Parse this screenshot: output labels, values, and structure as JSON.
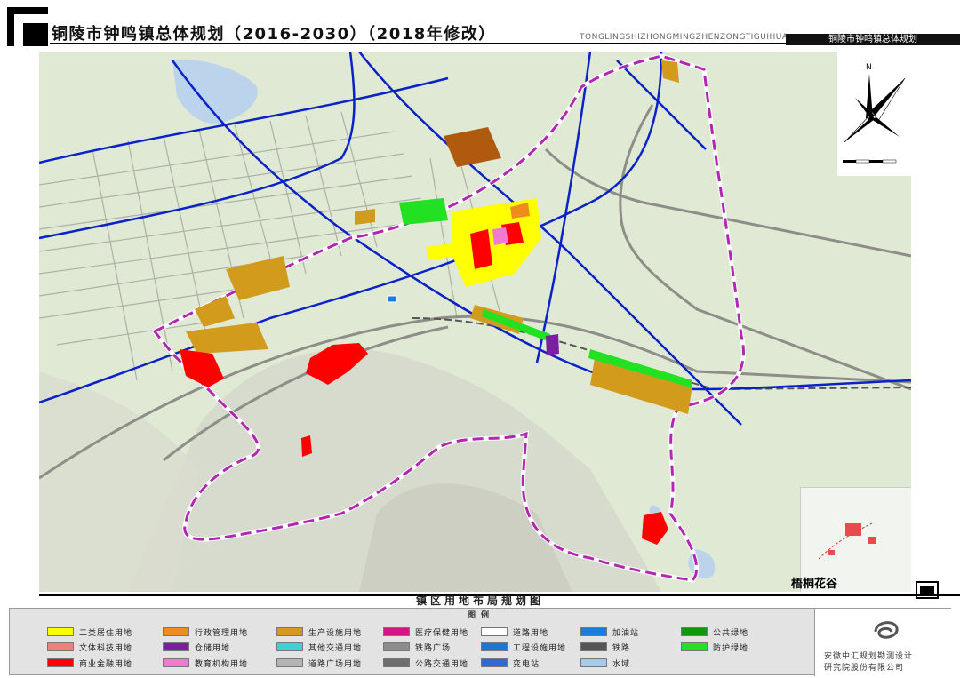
{
  "header": {
    "title": "铜陵市钟鸣镇总体规划（2016-2030）（2018年修改）",
    "pinyin": "TONGLINGSHIZHONGMINGZHENZONGTIGUIHUA",
    "right_label": "铜陵市钟鸣镇总体规划"
  },
  "map": {
    "title": "镇区用地布局规划图",
    "inset_label": "梧桐花谷",
    "compass_north": "N",
    "colors": {
      "background": "#dfe9d3",
      "terrain": "#d3d3c8",
      "water": "#bcd3ec",
      "road_major": "#0a22c8",
      "boundary": "#b226b2"
    }
  },
  "legend": {
    "title": "图例",
    "items": [
      {
        "label": "二类居住用地",
        "color": "#ffff00"
      },
      {
        "label": "文体科技用地",
        "color": "#f08080"
      },
      {
        "label": "商业金融用地",
        "color": "#ff0000"
      },
      {
        "label": "行政管理用地",
        "color": "#f08c1e"
      },
      {
        "label": "仓储用地",
        "color": "#7a1fa0"
      },
      {
        "label": "教育机构用地",
        "color": "#f07ad2"
      },
      {
        "label": "生产设施用地",
        "color": "#d39b1c"
      },
      {
        "label": "其他交通用地",
        "color": "#3fd0d0"
      },
      {
        "label": "道路广场用地",
        "color": "#b4b4b4"
      },
      {
        "label": "医疗保健用地",
        "color": "#d3158a"
      },
      {
        "label": "铁路广场",
        "color": "#8c8c8c"
      },
      {
        "label": "公路交通用地",
        "color": "#6e6e6e"
      },
      {
        "label": "道路用地",
        "color": "#ffffff"
      },
      {
        "label": "工程设施用地",
        "color": "#1e78d2"
      },
      {
        "label": "变电站",
        "color": "#2e6ad2"
      },
      {
        "label": "加油站",
        "color": "#1e7ae0"
      },
      {
        "label": "铁路",
        "color": "#555555"
      },
      {
        "label": "水域",
        "color": "#aac8ee"
      },
      {
        "label": "公共绿地",
        "color": "#0a9a0a"
      },
      {
        "label": "防护绿地",
        "color": "#22e022"
      }
    ],
    "org_line1": "安徽中汇规划勘测设计",
    "org_line2": "研究院股份有限公司"
  }
}
